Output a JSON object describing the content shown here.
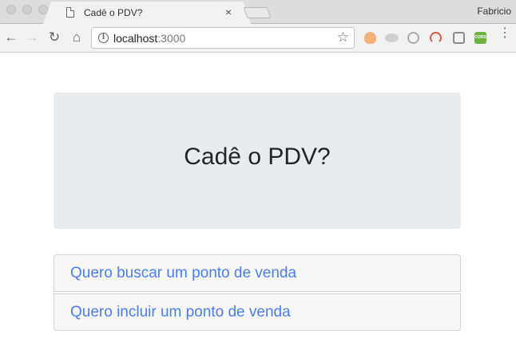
{
  "browser": {
    "tab_title": "Cadê o PDV?",
    "tab_close": "×",
    "profile_name": "Fabricio",
    "url_host": "localhost",
    "url_port": ":3000",
    "icons": {
      "back": "←",
      "forward": "→",
      "reload": "↻",
      "home": "⌂",
      "star": "☆",
      "info": "i",
      "menu": "⋮",
      "cors_ext": "CORS"
    }
  },
  "page": {
    "heading": "Cadê o PDV?",
    "links": [
      {
        "label": "Quero buscar um ponto de venda"
      },
      {
        "label": "Quero incluir um ponto de venda"
      }
    ]
  },
  "colors": {
    "link": "#4a7ef0",
    "jumbotron_bg": "#e9ecef",
    "heading": "#212529"
  }
}
